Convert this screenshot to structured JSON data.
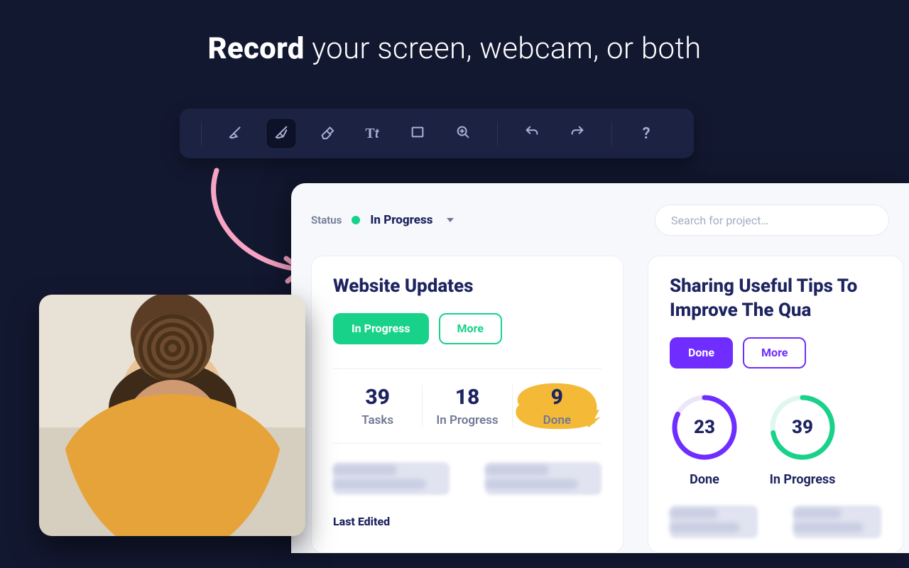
{
  "headline": {
    "bold": "Record",
    "rest": " your screen, webcam, or both"
  },
  "toolbar": {
    "icons": {
      "marker": "marker-icon",
      "brush": "brush-icon",
      "eraser": "eraser-icon",
      "text": "text-icon",
      "rect": "rectangle-icon",
      "zoom": "zoom-in-icon",
      "undo": "undo-icon",
      "redo": "redo-icon",
      "help": "help-icon"
    }
  },
  "app": {
    "status": {
      "label": "Status",
      "value": "In Progress"
    },
    "search": {
      "placeholder": "Search for project…"
    },
    "cards": [
      {
        "title": "Website Updates",
        "buttons": {
          "primary": "In Progress",
          "secondary": "More"
        },
        "stats": [
          {
            "num": "39",
            "lbl": "Tasks"
          },
          {
            "num": "18",
            "lbl": "In Progress"
          },
          {
            "num": "9",
            "lbl": "Done",
            "highlight": true
          }
        ],
        "last_edited_label": "Last Edited"
      },
      {
        "title": "Sharing Useful Tips To Improve The Qua",
        "buttons": {
          "primary": "Done",
          "secondary": "More"
        },
        "rings": [
          {
            "num": "23",
            "lbl": "Done",
            "color": "#6f2dff",
            "pct": 82
          },
          {
            "num": "39",
            "lbl": "In Progress",
            "color": "#19d28a",
            "pct": 72
          }
        ]
      }
    ]
  },
  "colors": {
    "accent_green": "#19d28a",
    "accent_purple": "#6f2dff",
    "highlight_yellow": "#f4b937",
    "arrow_pink": "#f8a4c4"
  }
}
